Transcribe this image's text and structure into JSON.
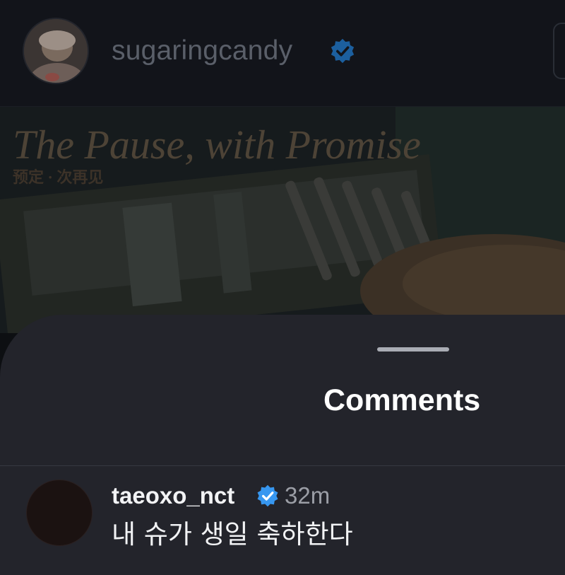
{
  "post": {
    "author": "sugaringcandy",
    "author_verified": true,
    "image_title": "The Pause, with Promise",
    "image_subtitle": "预定 · 次再见"
  },
  "comments_sheet": {
    "title": "Comments",
    "comments": [
      {
        "username": "taeoxo_nct",
        "verified": true,
        "time": "32m",
        "text": "내 슈가 생일 축하한다"
      }
    ]
  },
  "colors": {
    "sheet_bg": "#23242b",
    "verified_blue": "#3797f0",
    "backdrop": "#0d0f12"
  },
  "icons": [
    "verified-badge-icon"
  ]
}
